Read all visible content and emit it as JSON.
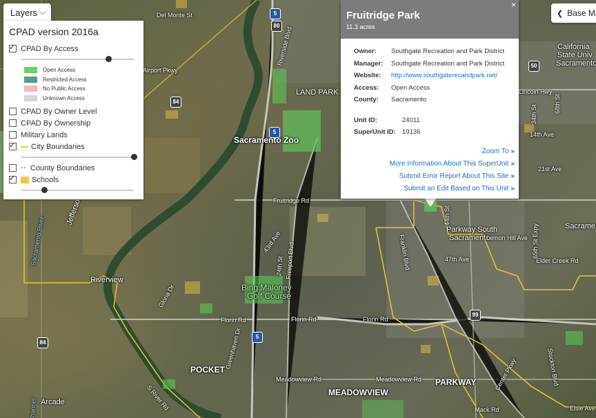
{
  "layers_button": {
    "label": "Layers"
  },
  "panel": {
    "title": "CPAD version 2016a",
    "cpad_by_access": {
      "label": "CPAD By Access",
      "checked": true,
      "opacity": 0.77
    },
    "legend": [
      {
        "label": "Open Access",
        "color": "#6fcf6a"
      },
      {
        "label": "Restricted Access",
        "color": "#4fa08a"
      },
      {
        "label": "No Public Access",
        "color": "#f3b8b8"
      },
      {
        "label": "Unknown Access",
        "color": "#d6d6d6"
      }
    ],
    "cpad_by_owner_level": {
      "label": "CPAD By Owner Level",
      "checked": false
    },
    "cpad_by_ownership": {
      "label": "CPAD By Ownership",
      "checked": false
    },
    "military_lands": {
      "label": "Military Lands",
      "checked": false
    },
    "city_boundaries": {
      "label": "City Boundaries",
      "checked": true,
      "opacity": 1.0,
      "color": "#f3c744"
    },
    "county_boundaries": {
      "label": "County Boundaries",
      "checked": false
    },
    "schools": {
      "label": "Schools",
      "checked": true,
      "opacity": 0.2
    }
  },
  "popup": {
    "title": "Fruitridge Park",
    "subtitle": "11.3 acres",
    "close": "×",
    "owner_label": "Owner:",
    "owner": "Southgate Recreation and Park District",
    "manager_label": "Manager:",
    "manager": "Southgate Recreation and Park District",
    "website_label": "Website:",
    "website": "http://www.southgaterecandpark.net/",
    "access_label": "Access:",
    "access": "Open Access",
    "county_label": "County:",
    "county": "Sacramento",
    "unit_id_label": "Unit ID:",
    "unit_id": "24011",
    "superunit_id_label": "SuperUnit ID:",
    "superunit_id": "19136",
    "links": [
      {
        "label": "Zoom To"
      },
      {
        "label": "More Information About This SuperUnit"
      },
      {
        "label": "Submit Error Report About This Site"
      },
      {
        "label": "Submit an Edit Based on This Unit"
      }
    ],
    "arrow": "»"
  },
  "basemap_button": {
    "label": "Base Ma"
  },
  "map_labels": {
    "del_monte": "Del Monte St",
    "airport": "Airport Pkwy",
    "riverside": "Riverside Blvd",
    "land_park": "LAND PARK",
    "zoo": "Sacramento Zoo",
    "jefferson": "Jefferson Blvd",
    "sacramento_river": "Sacramento River",
    "riverview": "Riverview",
    "gloria": "Gloria Dr",
    "bing": "Bing Maloney",
    "golf": "Golf Course",
    "florin1": "Florin Rd",
    "florin2": "Florin Rd",
    "florin3": "Florin Rd",
    "fruitridge": "Fruitridge Rd",
    "freeport": "Freeport Blvd",
    "pocket": "POCKET",
    "meadowview": "MEADOWVIEW",
    "meadowview_rd1": "Meadowview Rd",
    "meadowview_rd2": "Meadowview Rd",
    "parkway_south": "Parkway South",
    "parkway_south2": "Sacramento",
    "parkway": "PARKWAY",
    "lemon_hill": "Lemon Hill Ave",
    "elder_creek": "Elder Creek Rd",
    "california": "California",
    "state_univ": "State Univ",
    "sacramento_univ": "Sacramento",
    "lincoln": "Lincoln Hwy",
    "sacrame_right": "Sacrame",
    "arcade": "Arcade",
    "channel": "Channel",
    "mack": "Mack Rd",
    "elsie": "Elsie Ave",
    "s_river": "S River Rd",
    "greenhaven": "Greenhaven Dr",
    "st47": "47th Ave",
    "st43": "43rd Ave",
    "st24": "24th St",
    "franklin": "Franklin Blvd",
    "st44": "44th St",
    "st65": "65th St Expy",
    "stockton": "Stockton Blvd",
    "center_pkwy": "Center Pkwy",
    "st21": "21st Ave",
    "st14": "14th Ave",
    "st34": "34th St",
    "st68": "68th St"
  },
  "shields": {
    "i5_a": "5",
    "i5_b": "5",
    "i5_c": "5",
    "us50": "50",
    "ca99": "99",
    "r84a": "84",
    "r84b": "84",
    "i80": "80"
  }
}
